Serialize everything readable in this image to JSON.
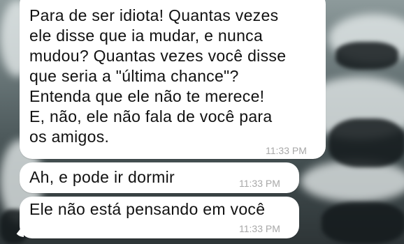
{
  "messages": [
    {
      "text": "Para de ser idiota! Quantas vezes\nele disse que ia mudar, e nunca\nmudou? Quantas vezes você disse\nque seria a \"última chance\"?\nEntenda que ele não te merece!\nE, não, ele não fala de você para\nos amigos.",
      "time": "11:33 PM"
    },
    {
      "text": "Ah, e pode ir dormir",
      "time": "11:33 PM"
    },
    {
      "text": "Ele não está pensando em você",
      "time": "11:33 PM"
    }
  ],
  "colors": {
    "bubble": "#ffffff",
    "timestamp": "#a8a8a8"
  }
}
